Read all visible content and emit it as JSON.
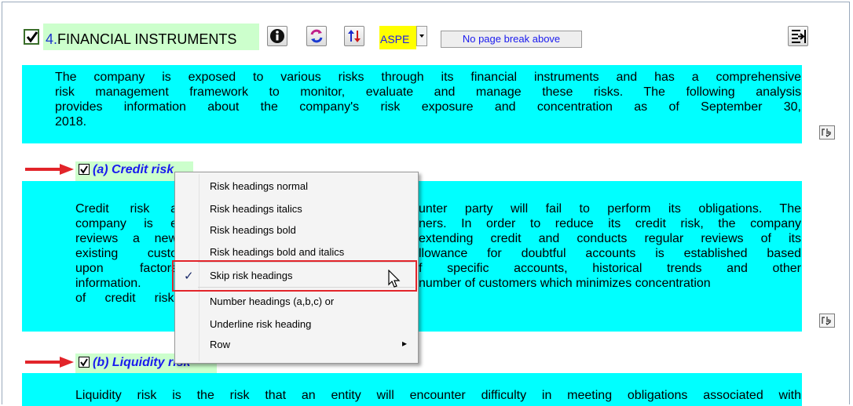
{
  "header": {
    "number": "4.",
    "title": "FINANCIAL INSTRUMENTS",
    "framework": "ASPE",
    "page_break_label": "No page break above"
  },
  "intro_paragraph": {
    "lines": [
      "The company is exposed to various risks through its financial instruments and has a comprehensive",
      "risk management framework to monitor, evaluate and manage these risks.  The following analysis",
      "provides information about the company's risk exposure and concentration as of September 30,",
      "2018."
    ]
  },
  "credit_risk": {
    "heading": "(a) Credit risk",
    "lines": [
      "Credit risk a|unter party will fail to perform its obligations.  The",
      "company is e|ners.  In order to reduce its credit risk, the company",
      "reviews a new|extending credit and conducts regular reviews of its",
      "existing custo|llowance for doubtful accounts is established based",
      "upon factors|f  specific  accounts,  historical  trends  and  other",
      "information.|number of customers which minimizes concentration",
      "of credit risk.|"
    ]
  },
  "liquidity_risk": {
    "heading": "(b) Liquidity risk",
    "line": "Liquidity risk is the risk that an entity will encounter difficulty in meeting obligations associated with"
  },
  "context_menu": {
    "items": [
      {
        "label": "Risk headings normal"
      },
      {
        "label": "Risk headings italics"
      },
      {
        "label": "Risk headings bold"
      },
      {
        "label": "Risk headings bold and italics"
      },
      {
        "label": "Skip risk headings",
        "checked": true
      },
      {
        "label": "Number headings (a,b,c) or"
      },
      {
        "label": "Underline risk heading"
      },
      {
        "label": "Row",
        "has_submenu": true
      }
    ],
    "check_glyph": "✓",
    "submenu_glyph": "▸"
  },
  "colors": {
    "paragraph_bg": "#00ffff",
    "heading_bg": "#ccffcc",
    "heading_text": "#1a1aee",
    "aspe_bg": "#ffff00",
    "arrow": "#e2242a",
    "highlight": "#e2242a"
  },
  "icons": [
    "info-icon",
    "refresh-icon",
    "sort-icon",
    "export-icon",
    "edit-icon",
    "pointer-icon",
    "red-arrow-icon"
  ]
}
